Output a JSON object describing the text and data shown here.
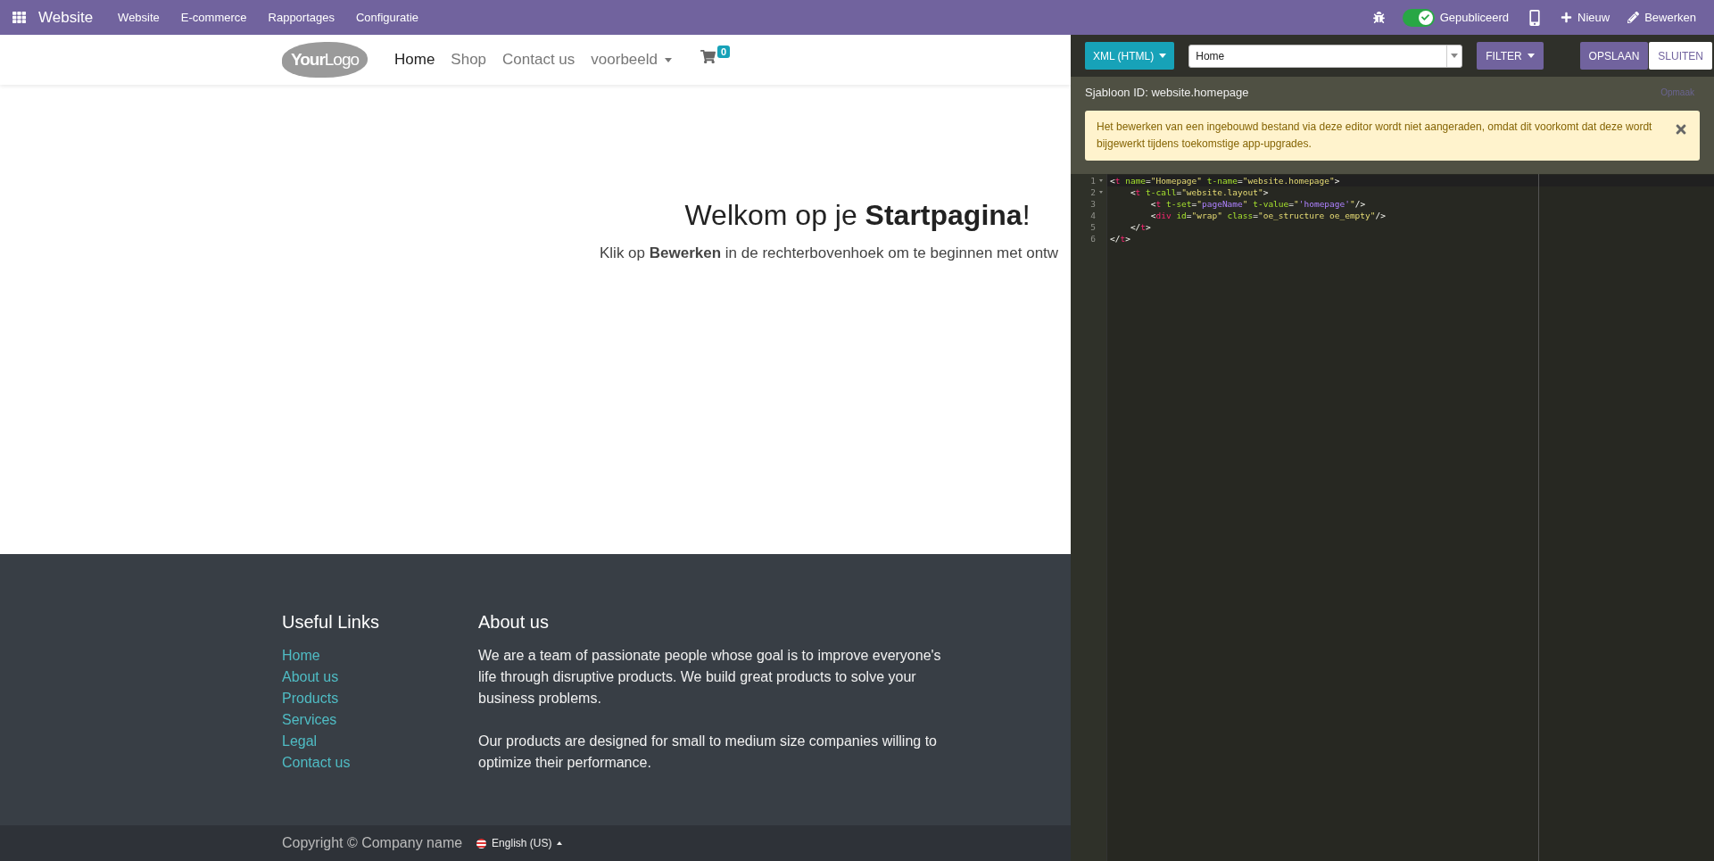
{
  "topbar": {
    "app": "Website",
    "menu": [
      "Website",
      "E-commerce",
      "Rapportages",
      "Configuratie"
    ],
    "published": {
      "on": true,
      "label": "Gepubliceerd"
    },
    "new": "Nieuw",
    "edit": "Bewerken"
  },
  "site_nav": {
    "logo": {
      "bold": "Your",
      "light": "Logo"
    },
    "items": [
      {
        "label": "Home",
        "selected": true,
        "dropdown": false
      },
      {
        "label": "Shop",
        "selected": false,
        "dropdown": false
      },
      {
        "label": "Contact us",
        "selected": false,
        "dropdown": false
      },
      {
        "label": "voorbeeld",
        "selected": false,
        "dropdown": true
      }
    ],
    "cart_count": "0"
  },
  "hero": {
    "title": "Welkom op je **Startpagina**!",
    "subtitle": "Klik op **Bewerken** in de rechterbovenhoek om te beginnen met ontw"
  },
  "footer": {
    "links_title": "Useful Links",
    "links": [
      "Home",
      "About us",
      "Products",
      "Services",
      "Legal",
      "Contact us"
    ],
    "about_title": "About us",
    "about": [
      "We are a team of passionate people whose goal is to improve everyone's life through disruptive products. We build great products to solve your business problems.",
      "Our products are designed for small to medium size companies willing to optimize their performance."
    ]
  },
  "bottom_bar": {
    "copyright": "Copyright © Company name",
    "language": "English (US)"
  },
  "editor": {
    "type_button": "XML (HTML)",
    "view_select": "Home",
    "filter": "FILTER",
    "save": "OPSLAAN",
    "close": "SLUITEN",
    "template_id": "Sjabloon ID: website.homepage",
    "format_link": "Opmaak",
    "warning": "Het bewerken van een ingebouwd bestand via deze editor wordt niet aangeraden, omdat dit voorkomt dat deze wordt bijgewerkt tijdens toekomstige app-upgrades.",
    "lines": [
      {
        "number": "1",
        "fold": true,
        "tokens": [
          {
            "kind": "punct",
            "text": "<"
          },
          {
            "kind": "tag",
            "text": "t"
          },
          {
            "kind": "attr",
            "text": " name"
          },
          {
            "kind": "punct",
            "text": "="
          },
          {
            "kind": "str",
            "text": "\"Homepage\""
          },
          {
            "kind": "attr",
            "text": " t-name"
          },
          {
            "kind": "punct",
            "text": "="
          },
          {
            "kind": "str",
            "text": "\"website.homepage\""
          },
          {
            "kind": "punct",
            "text": ">"
          }
        ]
      },
      {
        "number": "2",
        "fold": true,
        "tokens": [
          {
            "kind": "punct",
            "text": "    <"
          },
          {
            "kind": "tag",
            "text": "t"
          },
          {
            "kind": "attr",
            "text": " t-call"
          },
          {
            "kind": "punct",
            "text": "="
          },
          {
            "kind": "str",
            "text": "\"website.layout\""
          },
          {
            "kind": "punct",
            "text": ">"
          }
        ]
      },
      {
        "number": "3",
        "fold": false,
        "tokens": [
          {
            "kind": "punct",
            "text": "        <"
          },
          {
            "kind": "tag",
            "text": "t"
          },
          {
            "kind": "attr",
            "text": " t-set"
          },
          {
            "kind": "punct",
            "text": "="
          },
          {
            "kind": "str",
            "text": "\""
          },
          {
            "kind": "var",
            "text": "pageName"
          },
          {
            "kind": "str",
            "text": "\""
          },
          {
            "kind": "attr",
            "text": " t-value"
          },
          {
            "kind": "punct",
            "text": "="
          },
          {
            "kind": "str",
            "text": "\""
          },
          {
            "kind": "var",
            "text": "'homepage'"
          },
          {
            "kind": "str",
            "text": "\""
          },
          {
            "kind": "punct",
            "text": "/>"
          }
        ]
      },
      {
        "number": "4",
        "fold": false,
        "tokens": [
          {
            "kind": "punct",
            "text": "        <"
          },
          {
            "kind": "tag",
            "text": "div"
          },
          {
            "kind": "attr",
            "text": " id"
          },
          {
            "kind": "punct",
            "text": "="
          },
          {
            "kind": "str",
            "text": "\"wrap\""
          },
          {
            "kind": "attr",
            "text": " class"
          },
          {
            "kind": "punct",
            "text": "="
          },
          {
            "kind": "str",
            "text": "\"oe_structure oe_empty\""
          },
          {
            "kind": "punct",
            "text": "/>"
          }
        ]
      },
      {
        "number": "5",
        "fold": false,
        "tokens": [
          {
            "kind": "punct",
            "text": "    </"
          },
          {
            "kind": "tag",
            "text": "t"
          },
          {
            "kind": "punct",
            "text": ">"
          }
        ]
      },
      {
        "number": "6",
        "fold": false,
        "tokens": [
          {
            "kind": "punct",
            "text": "</"
          },
          {
            "kind": "tag",
            "text": "t"
          },
          {
            "kind": "punct",
            "text": ">"
          }
        ]
      }
    ]
  }
}
